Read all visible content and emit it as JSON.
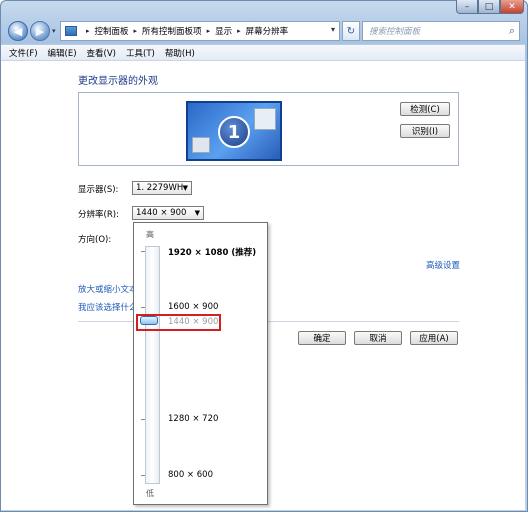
{
  "window": {
    "caption": {
      "minimize": "–",
      "maximize": "□",
      "close": "✕"
    }
  },
  "nav": {
    "back_glyph": "◀",
    "forward_glyph": "▶",
    "history_glyph": "▾"
  },
  "address": {
    "breadcrumbs": [
      "控制面板",
      "所有控制面板项",
      "显示",
      "屏幕分辨率"
    ],
    "separator": "▸",
    "dropdown_glyph": "▾",
    "refresh_glyph": "↻"
  },
  "search": {
    "placeholder": "搜索控制面板",
    "icon_glyph": "⌕"
  },
  "menu": [
    "文件(F)",
    "编辑(E)",
    "查看(V)",
    "工具(T)",
    "帮助(H)"
  ],
  "main": {
    "heading": "更改显示器的外观",
    "monitor_number": "1",
    "detect_label": "检测(C)",
    "identify_label": "识别(I)",
    "display_label": "显示器(S):",
    "display_value": "1. 2279WH",
    "resolution_label": "分辨率(R):",
    "resolution_value": "1440 × 900",
    "orientation_label": "方向(O):",
    "advanced_link": "高级设置",
    "text_size_link": "放大或缩小文本",
    "help_link": "我应该选择什么",
    "ok_label": "确定",
    "cancel_label": "取消",
    "apply_label": "应用(A)",
    "select_arrow": "▼"
  },
  "popup": {
    "high_label": "高",
    "low_label": "低",
    "options": [
      "1920 × 1080 (推荐)",
      "1600 × 900",
      "1440 × 900",
      "1280 × 720",
      "800 × 600"
    ],
    "selected": "1440 × 900"
  },
  "colors": {
    "link": "#1f5bbb",
    "heading": "#1e3b8c",
    "highlight_border": "#d21f1f"
  }
}
